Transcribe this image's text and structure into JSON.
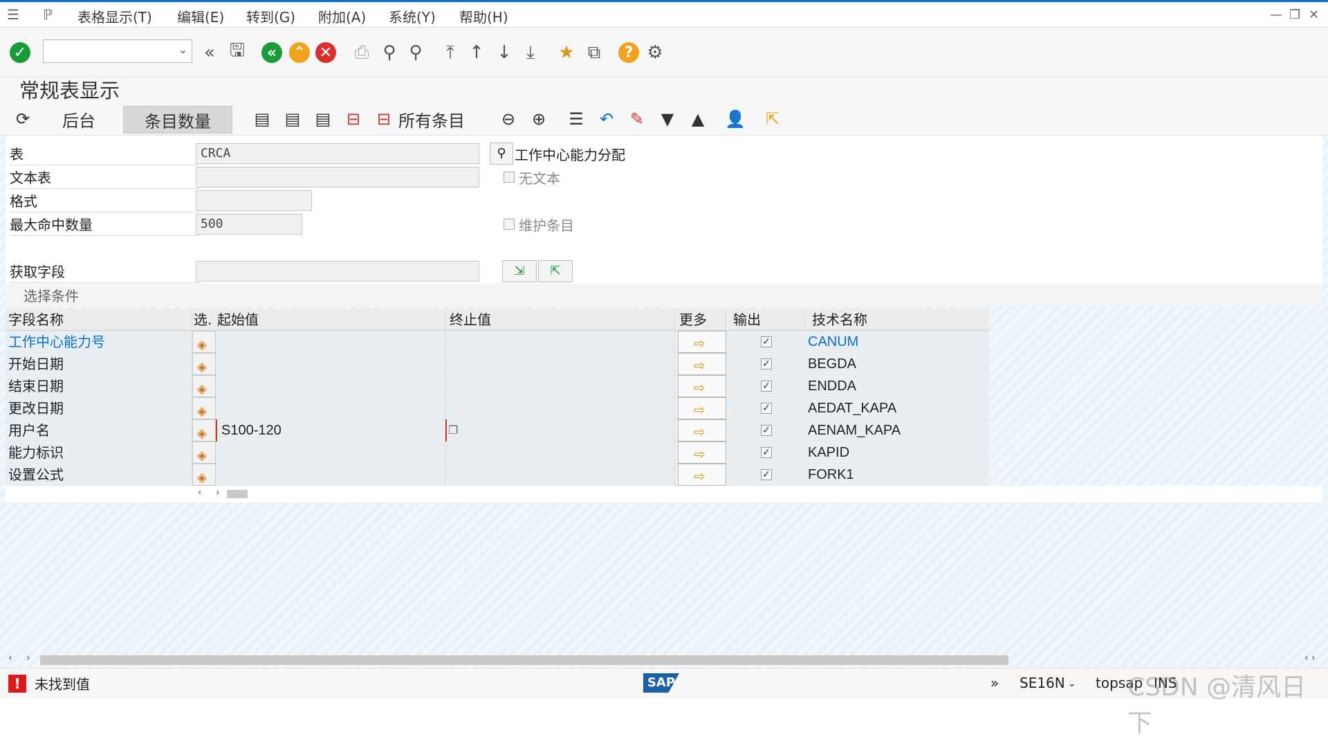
{
  "menu": {
    "items": [
      "表格显示(T)",
      "编辑(E)",
      "转到(G)",
      "附加(A)",
      "系统(Y)",
      "帮助(H)"
    ]
  },
  "title": "常规表显示",
  "app_toolbar": {
    "background": "后台",
    "entry_count": "条目数量",
    "all_entries": "所有条目"
  },
  "form": {
    "table_label": "表",
    "table_value": "CRCA",
    "table_desc": "工作中心能力分配",
    "text_table_label": "文本表",
    "text_table_value": "",
    "no_text_label": "无文本",
    "format_label": "格式",
    "format_value": "",
    "max_hits_label": "最大命中数量",
    "max_hits_value": "500",
    "maintain_entries_label": "维护条目",
    "get_fields_label": "获取字段",
    "get_fields_value": ""
  },
  "selection": {
    "title": "选择条件",
    "headers": {
      "field": "字段名称",
      "sel": "选.",
      "from": "起始值",
      "to": "终止值",
      "more": "更多",
      "output": "输出",
      "tech": "技术名称"
    },
    "rows": [
      {
        "field": "工作中心能力号",
        "from": "",
        "to": "",
        "output": true,
        "tech": "CANUM"
      },
      {
        "field": "开始日期",
        "from": "",
        "to": "",
        "output": true,
        "tech": "BEGDA"
      },
      {
        "field": "结束日期",
        "from": "",
        "to": "",
        "output": true,
        "tech": "ENDDA"
      },
      {
        "field": "更改日期",
        "from": "",
        "to": "",
        "output": true,
        "tech": "AEDAT_KAPA"
      },
      {
        "field": "用户名",
        "from": "S100-120",
        "to": "",
        "output": true,
        "tech": "AENAM_KAPA"
      },
      {
        "field": "能力标识",
        "from": "",
        "to": "",
        "output": true,
        "tech": "KAPID"
      },
      {
        "field": "设置公式",
        "from": "",
        "to": "",
        "output": true,
        "tech": "FORK1"
      }
    ]
  },
  "status": {
    "message": "未找到值",
    "transaction": "SE16N",
    "user": "topsap",
    "mode": "INS",
    "logo_text": "SAP",
    "watermark": "CSDN @清风日下"
  },
  "colors": {
    "accent": "#0a6ed1",
    "error": "#d91b1b",
    "ok_green": "#1a9b3a",
    "back_green": "#1a9b3a",
    "exit_orange": "#f0a21b",
    "cancel_red": "#d9302f",
    "help_orange": "#f0a21b"
  }
}
